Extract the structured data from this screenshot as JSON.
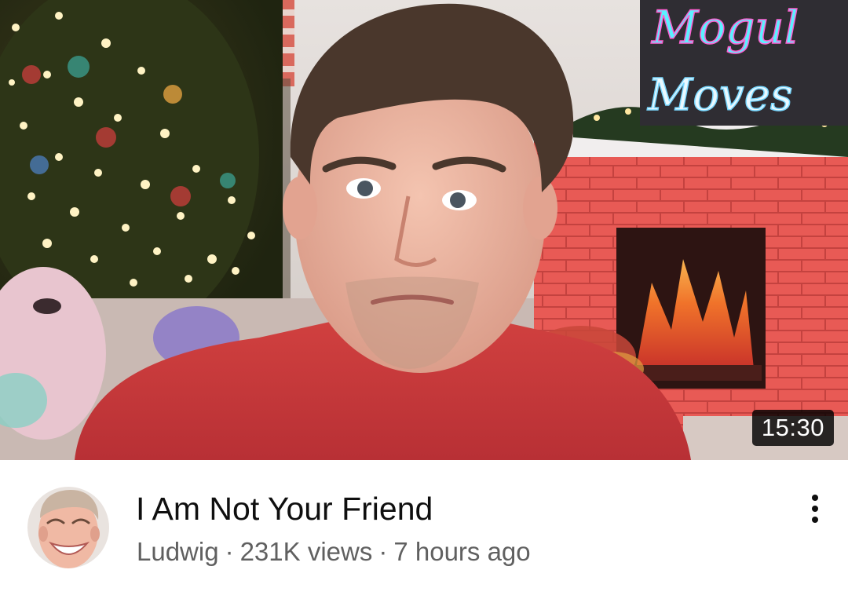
{
  "video": {
    "duration": "15:30",
    "title": "I Am Not Your Friend",
    "channel": "Ludwig",
    "separator": "·",
    "views": "231K views",
    "age": "7 hours ago"
  },
  "thumbnail_sign": {
    "line1": "Mogul",
    "line2": "Moves"
  },
  "icons": {
    "more": "more-vert-icon",
    "avatar": "channel-avatar"
  },
  "colors": {
    "title": "#0f0f0f",
    "meta": "#606060",
    "badge_bg": "#000000",
    "shirt": "#c8383a",
    "brick": "#e9524f"
  }
}
